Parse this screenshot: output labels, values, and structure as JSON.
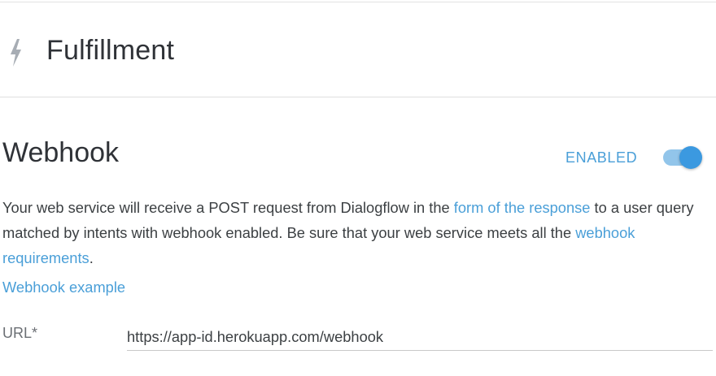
{
  "header": {
    "icon": "lightning-bolt-icon",
    "title": "Fulfillment"
  },
  "webhook": {
    "title": "Webhook",
    "status_label": "ENABLED",
    "toggle_on": true,
    "description": {
      "part1": "Your web service will receive a POST request from Dialogflow in the ",
      "link1": "form of the response",
      "part2": " to a user query matched by intents with webhook enabled. Be sure that your web service meets all the ",
      "link2": "webhook requirements",
      "part3": "."
    },
    "example_link": "Webhook example",
    "url_label": "URL*",
    "url_value": "https://app-id.herokuapp.com/webhook"
  },
  "colors": {
    "accent": "#4a9fd8",
    "toggle_track": "#92c5ea",
    "toggle_thumb": "#3b99e0",
    "title_text": "#2f3237"
  }
}
